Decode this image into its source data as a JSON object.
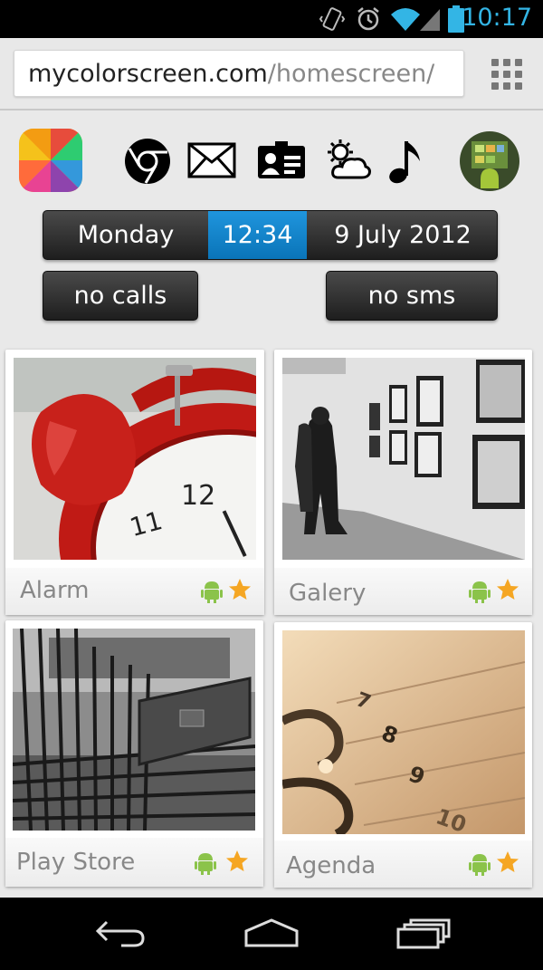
{
  "status_bar": {
    "time": "10:17",
    "icons": [
      "vibrate-icon",
      "alarm-icon",
      "wifi-icon",
      "signal-icon",
      "battery-icon"
    ],
    "time_color": "#33b5e5"
  },
  "address_bar": {
    "url_domain": "mycolorscreen.com",
    "url_path": "/homescreen/",
    "menu_icon": "apps-grid-icon"
  },
  "homescreen": {
    "top_icons": [
      "color-wheel-icon",
      "chrome-icon",
      "mail-icon",
      "contacts-card-icon",
      "weather-icon",
      "music-note-icon",
      "android-avatar-icon"
    ],
    "date_bar": {
      "day": "Monday",
      "time": "12:34",
      "date": "9 July 2012"
    },
    "calls_label": "no calls",
    "sms_label": "no sms",
    "apps": [
      {
        "label": "Alarm",
        "image": "alarm-clock-photo"
      },
      {
        "label": "Galery",
        "image": "gallery-photo"
      },
      {
        "label": "Play Store",
        "image": "shopping-cart-photo"
      },
      {
        "label": "Agenda",
        "image": "calendar-photo"
      }
    ]
  },
  "nav_bar": {
    "icons": [
      "back-icon",
      "home-icon",
      "recents-icon"
    ]
  },
  "colors": {
    "accent_blue": "#0a74b8",
    "pill_dark": "#2a2a2a",
    "page_bg": "#e9e9e9",
    "star": "#f5a623",
    "android_green": "#8bc34a"
  }
}
